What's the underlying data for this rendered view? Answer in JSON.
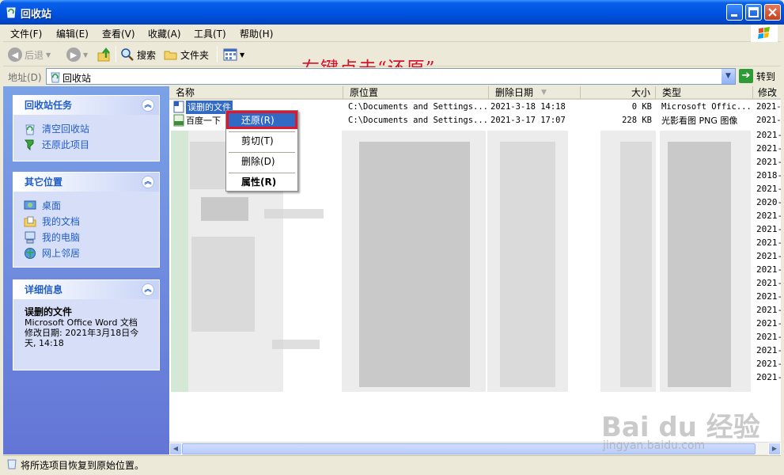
{
  "window": {
    "title": "回收站"
  },
  "menu": [
    "文件(F)",
    "编辑(E)",
    "查看(V)",
    "收藏(A)",
    "工具(T)",
    "帮助(H)"
  ],
  "toolbar": {
    "back": "后退",
    "search": "搜索",
    "folders": "文件夹"
  },
  "address": {
    "label": "地址(D)",
    "value": "回收站",
    "go": "转到"
  },
  "sidebar": {
    "tasks": {
      "title": "回收站任务",
      "items": [
        "清空回收站",
        "还原此项目"
      ]
    },
    "places": {
      "title": "其它位置",
      "items": [
        "桌面",
        "我的文档",
        "我的电脑",
        "网上邻居"
      ]
    },
    "details": {
      "title": "详细信息",
      "name": "误删的文件",
      "type": "Microsoft Office Word 文档",
      "modified": "修改日期: 2021年3月18日今天, 14:18"
    }
  },
  "columns": [
    "名称",
    "原位置",
    "删除日期",
    "大小",
    "类型",
    "修改"
  ],
  "files": [
    {
      "name": "误删的文件",
      "location": "C:\\Documents and Settings...",
      "deleted": "2021-3-18 14:18",
      "size": "0 KB",
      "type": "Microsoft Offic...",
      "modified": "2021-"
    },
    {
      "name": "百度一下",
      "location": "C:\\Documents and Settings...",
      "deleted": "2021-3-17 17:07",
      "size": "228 KB",
      "type": "光影看图 PNG 图像",
      "modified": "2021-"
    }
  ],
  "obscured_years": [
    "2021-",
    "2021-",
    "2021-",
    "2018-",
    "2021-",
    "2020-",
    "2021-",
    "2021-",
    "2021-",
    "2021-",
    "2021-",
    "2021-",
    "2021-",
    "2021-",
    "2021-",
    "2021-",
    "2021-",
    "2021-",
    "2021-"
  ],
  "context_menu": {
    "restore": "还原(R)",
    "cut": "剪切(T)",
    "delete": "删除(D)",
    "properties": "属性(R)"
  },
  "status": "将所选项目恢复到原始位置。",
  "annotation": "右键点击“还原”",
  "watermark": {
    "brand": "Bai du 经验",
    "url": "jingyan.baidu.com"
  },
  "colors": {
    "title_bar": "#0054e3",
    "sidebar": "#6f8fe0",
    "selection": "#316ac5",
    "annotation": "#e3152a"
  }
}
